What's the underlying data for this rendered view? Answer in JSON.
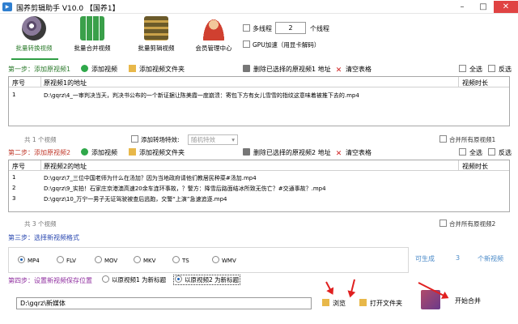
{
  "window": {
    "title": "国养剪辑助手 V10.0 【国养1】",
    "app_icon": "app-icon"
  },
  "toolbar": {
    "batch_convert": "批量转换视频",
    "batch_merge": "批量合并视频",
    "batch_cut": "批量剪辑视频",
    "member_center": "会员管理中心",
    "multithread_label": "多线程",
    "thread_count": "2",
    "thread_unit": "个线程",
    "gpu_label": "GPU加速（用显卡解码）"
  },
  "step1": {
    "title": "第一步：添加原视频1",
    "add_video": "添加视频",
    "add_folder": "添加视频文件夹",
    "delete_selected": "删除已选择的原视频1 地址",
    "clear": "清空表格",
    "select_all": "全选",
    "invert": "反选",
    "columns": [
      "序号",
      "原视频1的地址",
      "视频时长"
    ],
    "rows": [
      {
        "no": "1",
        "path": "D:\\gqrz\\4_一审判决当天，判决书公布的一个新证据让陈美霞一度崩溃：寄包下方有女儿雪雪的指纹这意味着被推下去的.mp4",
        "duration": ""
      }
    ],
    "total": "共 1 个视频",
    "transition_label": "添加转场特效:",
    "transition_value": "随机特效",
    "merge_all": "合并所有原视频1"
  },
  "step2": {
    "title": "第二步：添加原视频2",
    "add_video": "添加视频",
    "add_folder": "添加视频文件夹",
    "delete_selected": "删除已选择的原视频2 地址",
    "clear": "清空表格",
    "select_all": "全选",
    "invert": "反选",
    "columns": [
      "序号",
      "原视频2的地址",
      "视频时长"
    ],
    "rows": [
      {
        "no": "1",
        "path": "D:\\gqrz\\7_三位中国老师为什么在汤加？因为当地政府请他们教居民种菜#汤加.mp4",
        "duration": ""
      },
      {
        "no": "2",
        "path": "D:\\gqrz\\9_实拍！石家庄京港澳高速20余车连环事故，？警方：降雪后路面结冰所致无伤亡？#交通事故？.mp4",
        "duration": ""
      },
      {
        "no": "3",
        "path": "D:\\gqrz\\10_万宁一男子无证驾驶被查后逃跑，交警“上演”急速追逐.mp4",
        "duration": ""
      }
    ],
    "total": "共 3 个视频",
    "merge_all": "合并所有原视频2"
  },
  "step3": {
    "title": "第三步：选择新视频格式",
    "formats": [
      "MP4",
      "FLV",
      "MOV",
      "MKV",
      "TS",
      "WMV"
    ],
    "selected_format": "MP4",
    "generate_label": "可生成",
    "generate_count": "3",
    "generate_unit": "个新视频"
  },
  "step4": {
    "title": "第四步：设置新视频保存位置",
    "option1": "以原视频1 为新标题",
    "option2": "以原视频2 为新标题",
    "selected_option": "option2",
    "destination": "D:\\gqrz\\新媒体",
    "browse": "浏览",
    "open_folder": "打开文件夹",
    "start_merge": "开始合并"
  },
  "colors": {
    "step1": "#2c7a2c",
    "step2": "#c0392b",
    "step3": "#2a48b0",
    "step4": "#9030a0",
    "annotation_arrow": "#e02020"
  }
}
